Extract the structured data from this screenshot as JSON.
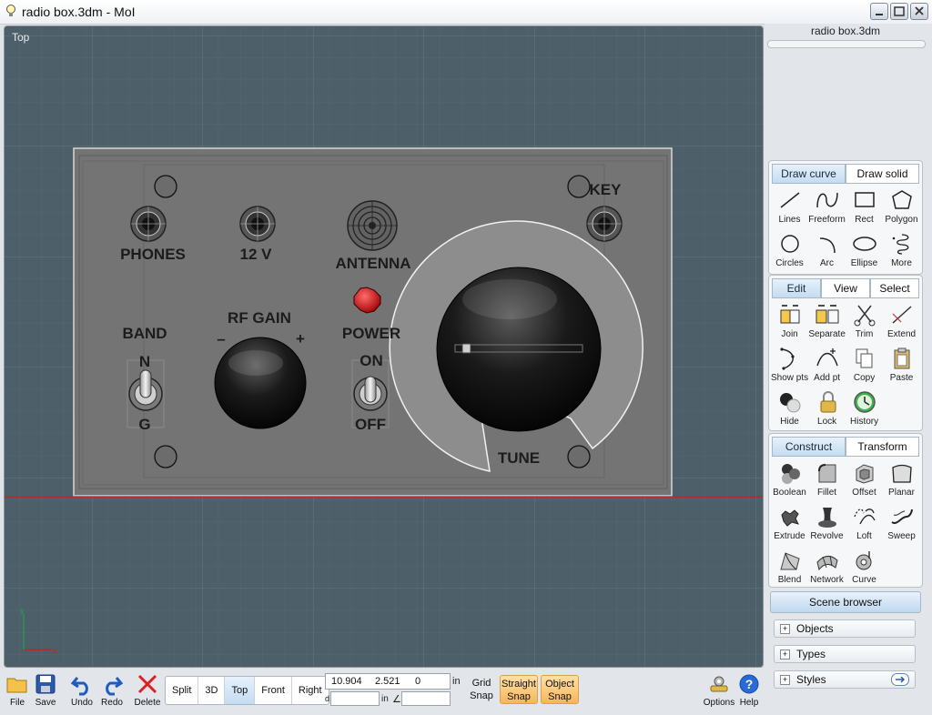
{
  "window": {
    "title": "radio box.3dm - MoI"
  },
  "viewport": {
    "name": "Top",
    "panel_labels": {
      "phones": "PHONES",
      "v12": "12 V",
      "antenna": "ANTENNA",
      "key": "KEY",
      "band": "BAND",
      "band_n": "N",
      "band_g": "G",
      "rf_gain": "RF GAIN",
      "minus": "–",
      "plus": "+",
      "power": "POWER",
      "on": "ON",
      "off": "OFF",
      "tune": "TUNE"
    },
    "axes": {
      "x": "x",
      "y": "y"
    }
  },
  "panel": {
    "filename": "radio box.3dm",
    "draw": {
      "tabs": [
        "Draw curve",
        "Draw solid"
      ],
      "tools": [
        "Lines",
        "Freeform",
        "Rect",
        "Polygon",
        "Circles",
        "Arc",
        "Ellipse",
        "More"
      ]
    },
    "edit": {
      "tabs": [
        "Edit",
        "View",
        "Select"
      ],
      "tools": [
        "Join",
        "Separate",
        "Trim",
        "Extend",
        "Show pts",
        "Add pt",
        "Copy",
        "Paste",
        "Hide",
        "Lock",
        "History"
      ]
    },
    "construct": {
      "tabs": [
        "Construct",
        "Transform"
      ],
      "tools": [
        "Boolean",
        "Fillet",
        "Offset",
        "Planar",
        "Extrude",
        "Revolve",
        "Loft",
        "Sweep",
        "Blend",
        "Network",
        "Curve"
      ]
    },
    "scene": {
      "title": "Scene browser",
      "items": [
        "Objects",
        "Types",
        "Styles"
      ]
    }
  },
  "toolbar": {
    "file": "File",
    "save": "Save",
    "undo": "Undo",
    "redo": "Redo",
    "delete": "Delete",
    "views": [
      "Split",
      "3D",
      "Top",
      "Front",
      "Right"
    ],
    "active_view": "Top",
    "coords": {
      "x": "10.904",
      "y": "2.521",
      "z": "0",
      "unit": "in",
      "d": "d",
      "in2": "in",
      "angle": "∠"
    },
    "grid_snap": [
      "Grid",
      "Snap"
    ],
    "straight_snap": [
      "Straight",
      "Snap"
    ],
    "object_snap": [
      "Object",
      "Snap"
    ],
    "options": "Options",
    "help": "Help"
  },
  "colors": {
    "accent": "#c3dcf2",
    "snap": "#f6b65a",
    "viewport_bg": "#4d6069",
    "axis_x": "#e01818",
    "axis_y": "#1fa34a"
  }
}
